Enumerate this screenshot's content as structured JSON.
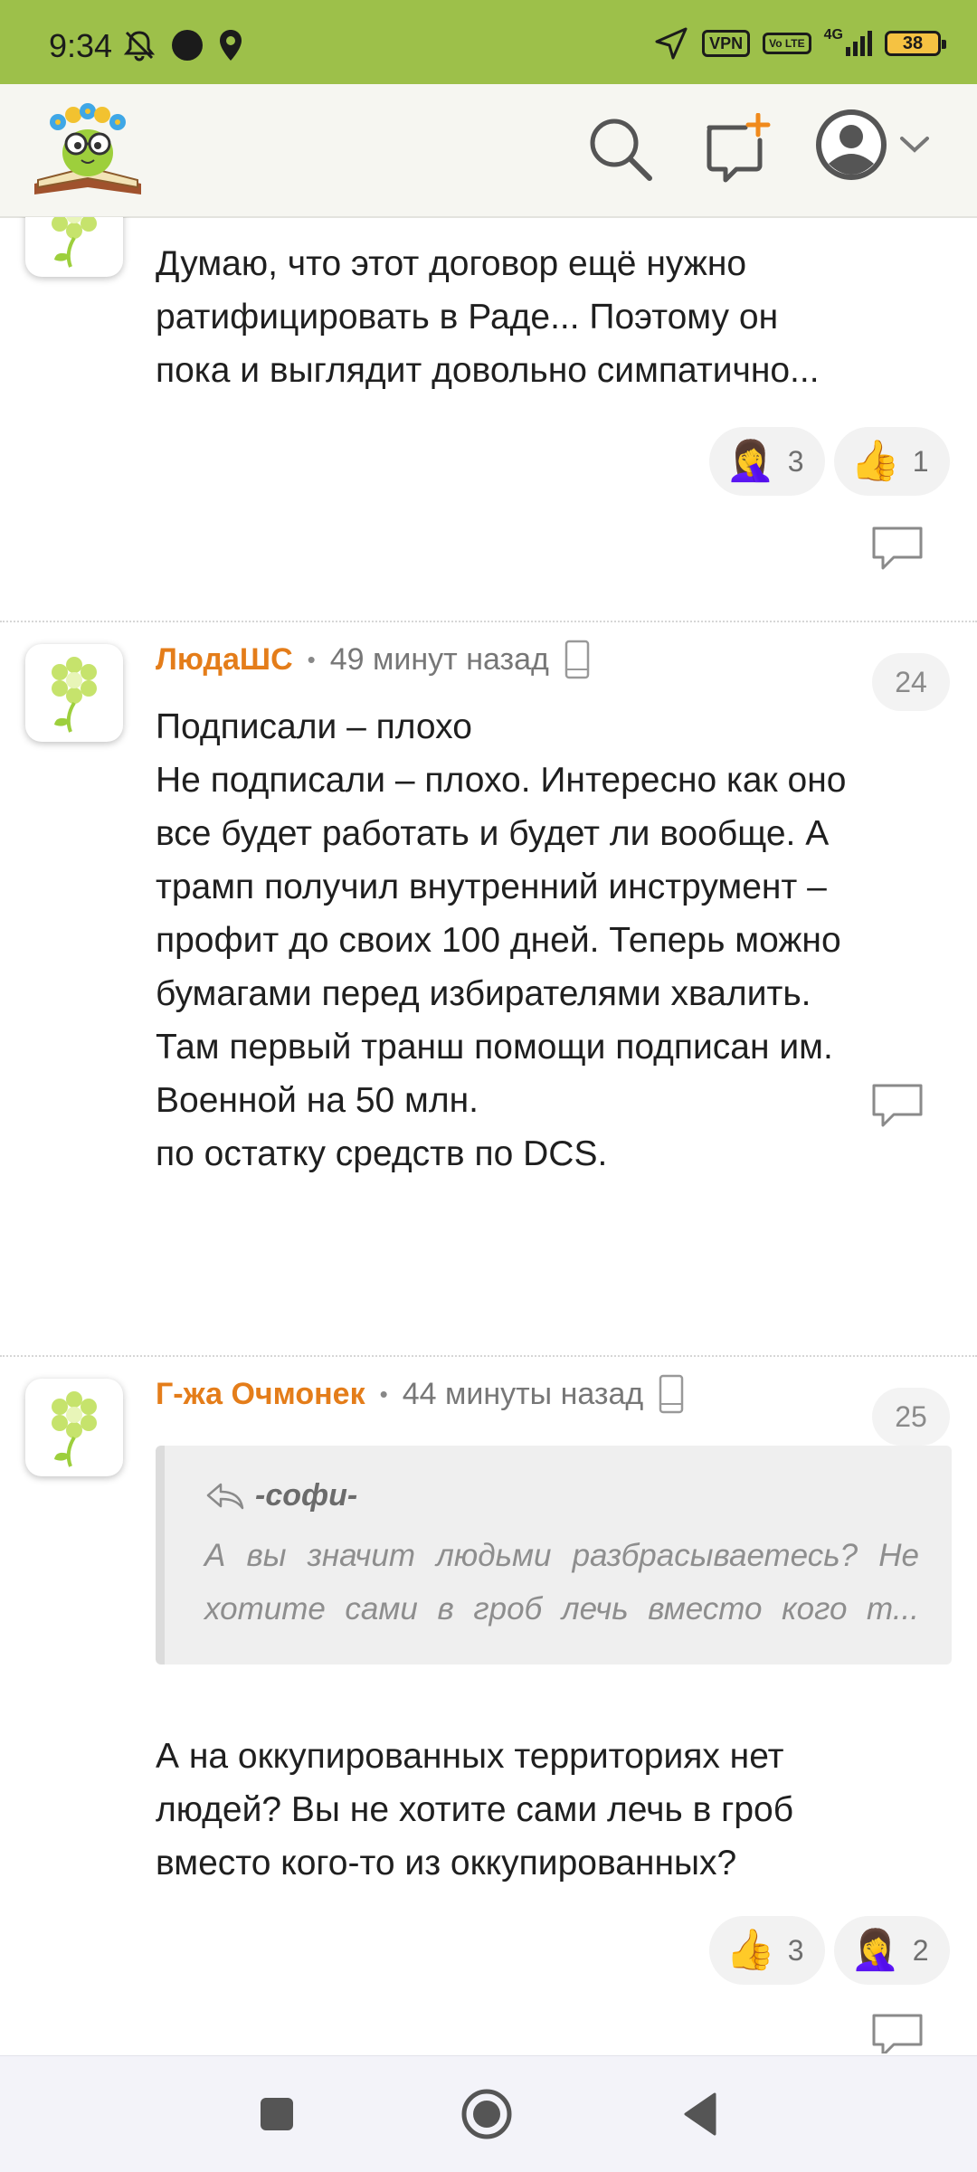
{
  "status_bar": {
    "time": "9:34",
    "vpn": "VPN",
    "volte": "Vo LTE",
    "network": "4G",
    "battery": "38"
  },
  "header": {
    "logo": "book-owl-logo",
    "search_icon": "search-icon",
    "new_post_icon": "new-post-icon",
    "avatar_icon": "user-avatar-icon"
  },
  "comments": [
    {
      "text": "Думаю, что этот договор ещё нужно\nратифицировать в Раде... Поэтому он\nпока и выглядит довольно симпатично...",
      "reactions": [
        {
          "emoji": "🤦‍♀️",
          "count": "3"
        },
        {
          "emoji": "👍",
          "count": "1"
        }
      ]
    },
    {
      "author": "ЛюдаШС",
      "time": "49 минут назад",
      "number": "24",
      "text": "Подписали – плохо\nНе подписали – плохо. Интересно как оно\nвсе будет работать и будет ли вообще. А\nтрамп получил внутренний инструмент –\nпрофит до своих 100 дней. Теперь можно\nбумагами перед избирателями хвалить.\nТам первый транш помощи подписан им.\nВоенной на 50 млн.\nпо остатку средств по DCS."
    },
    {
      "author": "Г-жа Очмонек",
      "time": "44 минуты назад",
      "number": "25",
      "quote_author": "-софи-",
      "quote_text": "А вы значит людьми разбрасываетесь? Не\nхотите сами в гроб лечь вместо кого т...",
      "text": "А на оккупированных территориях нет\nлюдей? Вы не хотите сами лечь в гроб\nвместо кого-то из оккупированных?",
      "reactions": [
        {
          "emoji": "👍",
          "count": "3"
        },
        {
          "emoji": "🤦‍♀️",
          "count": "2"
        }
      ]
    }
  ],
  "colors": {
    "status_bar": "#9dc04a",
    "author": "#e47d1a",
    "accent": "#f08a1c"
  }
}
